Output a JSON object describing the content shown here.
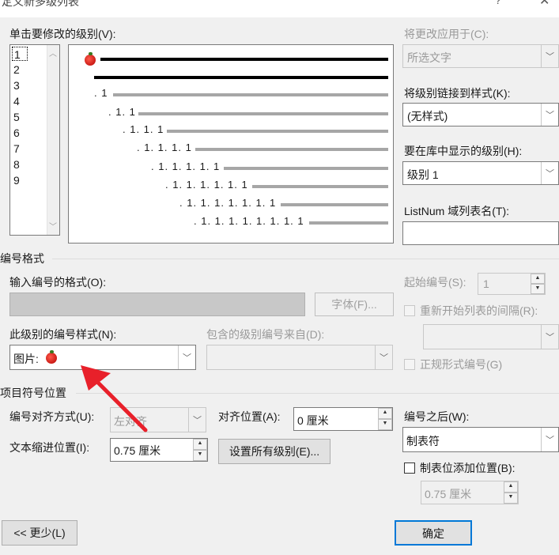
{
  "window": {
    "title": "定义新多级列表",
    "help": "?",
    "close": "✕"
  },
  "level_section": {
    "label": "单击要修改的级别(V):",
    "levels": [
      "1",
      "2",
      "3",
      "4",
      "5",
      "6",
      "7",
      "8",
      "9"
    ],
    "selected": "1"
  },
  "preview": {
    "rows": [
      ". 1",
      ". 1. 1",
      ". 1. 1. 1",
      ". 1. 1. 1. 1",
      ". 1. 1. 1. 1. 1",
      ". 1. 1. 1. 1. 1. 1",
      ". 1. 1. 1. 1. 1. 1. 1",
      ". 1. 1. 1. 1. 1. 1. 1. 1"
    ],
    "bullet_icon": "apple-picture-icon"
  },
  "right_panel": {
    "apply_to_label": "将更改应用于(C):",
    "apply_to_value": "所选文字",
    "link_style_label": "将级别链接到样式(K):",
    "link_style_value": "(无样式)",
    "gallery_level_label": "要在库中显示的级别(H):",
    "gallery_level_value": "级别 1",
    "listnum_label": "ListNum 域列表名(T):",
    "listnum_value": ""
  },
  "number_format": {
    "section_label": "编号格式",
    "format_label": "输入编号的格式(O):",
    "font_button": "字体(F)...",
    "style_label": "此级别的编号样式(N):",
    "style_value": "图片:",
    "include_label": "包含的级别编号来自(D):",
    "start_at_label": "起始编号(S):",
    "start_at_value": "1",
    "restart_label": "重新开始列表的间隔(R):",
    "legal_label": "正规形式编号(G)"
  },
  "position": {
    "section_label": "项目符号位置",
    "alignment_label": "编号对齐方式(U):",
    "alignment_value": "左对齐",
    "aligned_at_label": "对齐位置(A):",
    "aligned_at_value": "0 厘米",
    "indent_label": "文本缩进位置(I):",
    "indent_value": "0.75 厘米",
    "set_all_button": "设置所有级别(E)...",
    "follow_label": "编号之后(W):",
    "follow_value": "制表符",
    "tab_stop_label": "制表位添加位置(B):",
    "tab_stop_value": "0.75 厘米"
  },
  "footer": {
    "less_button": "<< 更少(L)",
    "ok_button": "确定"
  },
  "colors": {
    "annotation_arrow": "#e8202a"
  }
}
